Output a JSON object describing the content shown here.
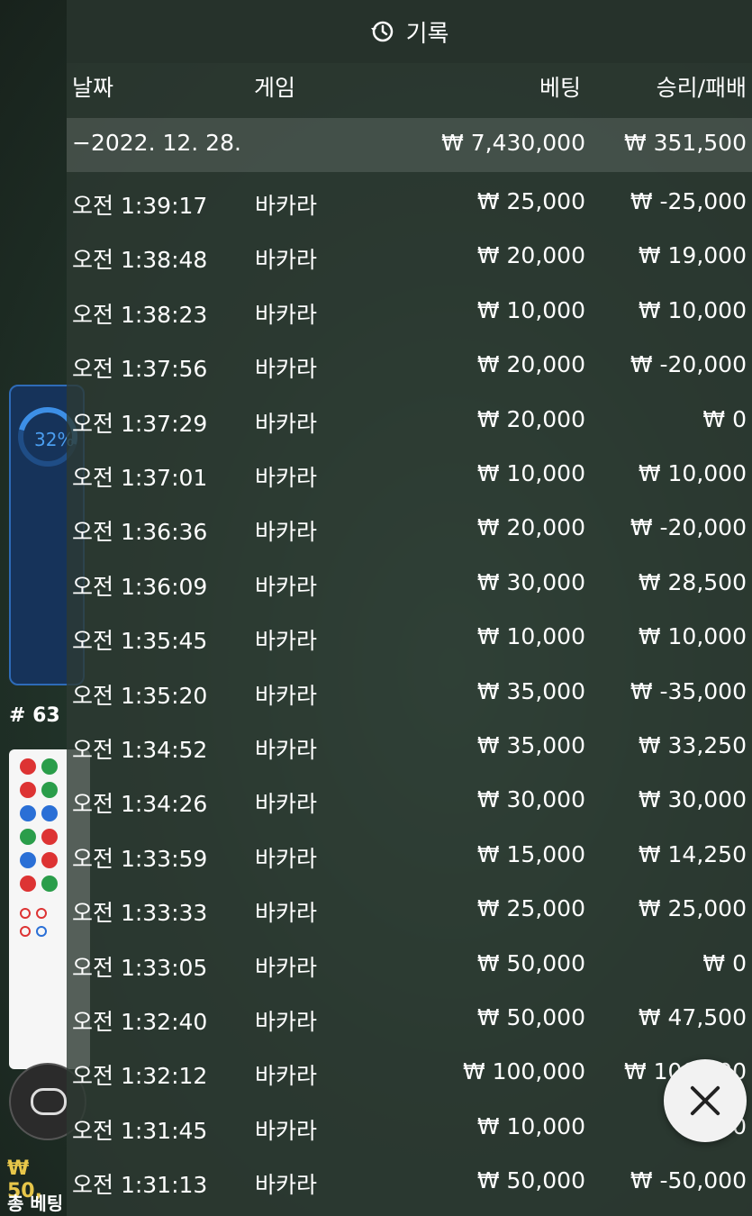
{
  "background": {
    "percent": "32%",
    "round": "# 63",
    "bet_amount": "₩ 50,",
    "total_bet": "총 베팅"
  },
  "header": {
    "title": "기록",
    "icon": "history-icon"
  },
  "columns": {
    "date": "날짜",
    "game": "게임",
    "bet": "베팅",
    "result": "승리/패배"
  },
  "summary": {
    "date": "−2022. 12. 28.",
    "bet": "₩ 7,430,000",
    "result": "₩ 351,500"
  },
  "rows": [
    {
      "time": "오전 1:39:17",
      "game": "바카라",
      "bet": "₩ 25,000",
      "result": "₩ -25,000"
    },
    {
      "time": "오전 1:38:48",
      "game": "바카라",
      "bet": "₩ 20,000",
      "result": "₩ 19,000"
    },
    {
      "time": "오전 1:38:23",
      "game": "바카라",
      "bet": "₩ 10,000",
      "result": "₩ 10,000"
    },
    {
      "time": "오전 1:37:56",
      "game": "바카라",
      "bet": "₩ 20,000",
      "result": "₩ -20,000"
    },
    {
      "time": "오전 1:37:29",
      "game": "바카라",
      "bet": "₩ 20,000",
      "result": "₩ 0"
    },
    {
      "time": "오전 1:37:01",
      "game": "바카라",
      "bet": "₩ 10,000",
      "result": "₩ 10,000"
    },
    {
      "time": "오전 1:36:36",
      "game": "바카라",
      "bet": "₩ 20,000",
      "result": "₩ -20,000"
    },
    {
      "time": "오전 1:36:09",
      "game": "바카라",
      "bet": "₩ 30,000",
      "result": "₩ 28,500"
    },
    {
      "time": "오전 1:35:45",
      "game": "바카라",
      "bet": "₩ 10,000",
      "result": "₩ 10,000"
    },
    {
      "time": "오전 1:35:20",
      "game": "바카라",
      "bet": "₩ 35,000",
      "result": "₩ -35,000"
    },
    {
      "time": "오전 1:34:52",
      "game": "바카라",
      "bet": "₩ 35,000",
      "result": "₩ 33,250"
    },
    {
      "time": "오전 1:34:26",
      "game": "바카라",
      "bet": "₩ 30,000",
      "result": "₩ 30,000"
    },
    {
      "time": "오전 1:33:59",
      "game": "바카라",
      "bet": "₩ 15,000",
      "result": "₩ 14,250"
    },
    {
      "time": "오전 1:33:33",
      "game": "바카라",
      "bet": "₩ 25,000",
      "result": "₩ 25,000"
    },
    {
      "time": "오전 1:33:05",
      "game": "바카라",
      "bet": "₩ 50,000",
      "result": "₩ 0"
    },
    {
      "time": "오전 1:32:40",
      "game": "바카라",
      "bet": "₩ 50,000",
      "result": "₩ 47,500"
    },
    {
      "time": "오전 1:32:12",
      "game": "바카라",
      "bet": "₩ 100,000",
      "result": "₩ 100,000"
    },
    {
      "time": "오전 1:31:45",
      "game": "바카라",
      "bet": "₩ 10,000",
      "result": "₩ 0"
    },
    {
      "time": "오전 1:31:13",
      "game": "바카라",
      "bet": "₩ 50,000",
      "result": "₩ -50,000"
    }
  ],
  "close_icon": "close-icon",
  "colors": {
    "panel": "#2d3a32",
    "text": "#ffffff",
    "accent_gold": "#e7c64a",
    "accent_blue": "#2e6bb8"
  }
}
